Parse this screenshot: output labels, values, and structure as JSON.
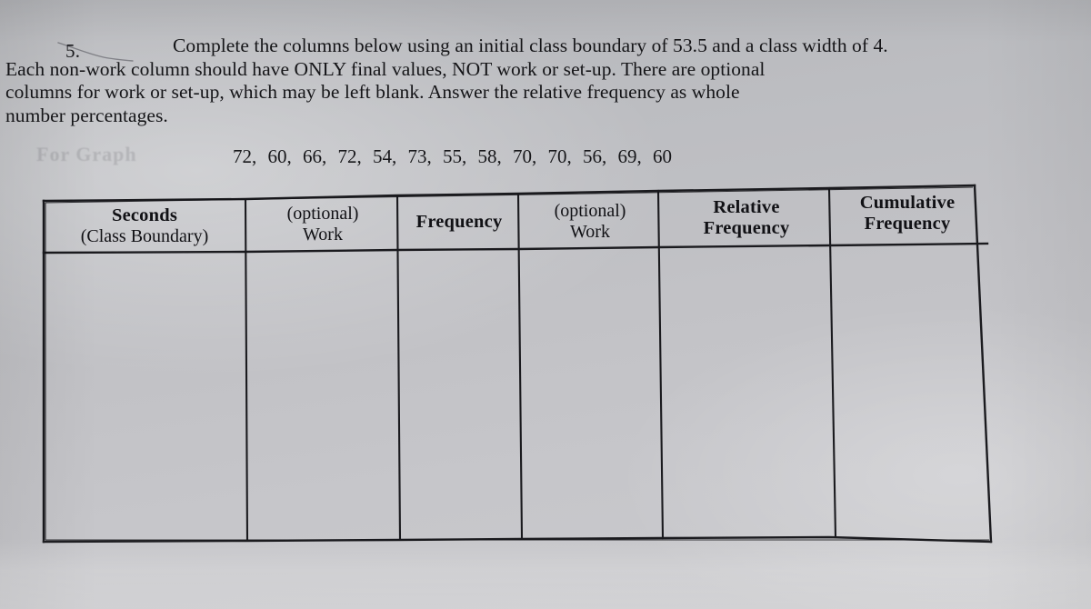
{
  "document": {
    "type": "statistics-worksheet",
    "question_number": "5.",
    "ghost_text": "For Graph"
  },
  "prompt": {
    "line1": "Complete the columns below using an initial class boundary of 53.5 and a class width of 4.",
    "line2": "Each non-work column should have ONLY final values, NOT work or set-up.  There are optional",
    "line3": "columns for work or set-up, which may be left blank.  Answer the relative frequency as whole",
    "line4": "number percentages."
  },
  "dataset": {
    "label": "data values",
    "values": [
      "72,",
      "60,",
      "66,",
      "72,",
      "54,",
      "73,",
      "55,",
      "58,",
      "70,",
      "70,",
      "56,",
      "69,",
      "60"
    ],
    "raw": [
      72,
      60,
      66,
      72,
      54,
      73,
      55,
      58,
      70,
      70,
      56,
      69,
      60
    ],
    "count": 13
  },
  "parameters": {
    "initial_class_boundary": "53.5",
    "class_width": "4",
    "relative_frequency_format": "whole number percentages"
  },
  "table": {
    "headers": [
      {
        "bold_line": "Seconds",
        "plain_line": "(Class Boundary)",
        "order": "bold-first"
      },
      {
        "plain_line": "(optional)",
        "bold_line": "Work",
        "order": "plain-first",
        "work_plain": true
      },
      {
        "bold_line": "Frequency",
        "plain_line": "",
        "order": "bold-only"
      },
      {
        "plain_line": "(optional)",
        "bold_line": "Work",
        "order": "plain-first",
        "work_plain": true
      },
      {
        "bold_line": "Relative",
        "plain_line": "Frequency",
        "order": "bold-both"
      },
      {
        "bold_line": "Cumulative",
        "plain_line": "Frequency",
        "order": "bold-both"
      }
    ],
    "body_rows": 1,
    "body_cells": [
      "",
      "",
      "",
      "",
      "",
      ""
    ],
    "empty": true
  },
  "colors": {
    "paper": "#c2c2c6",
    "ink": "#151518",
    "rule": "#1a1a1e"
  }
}
